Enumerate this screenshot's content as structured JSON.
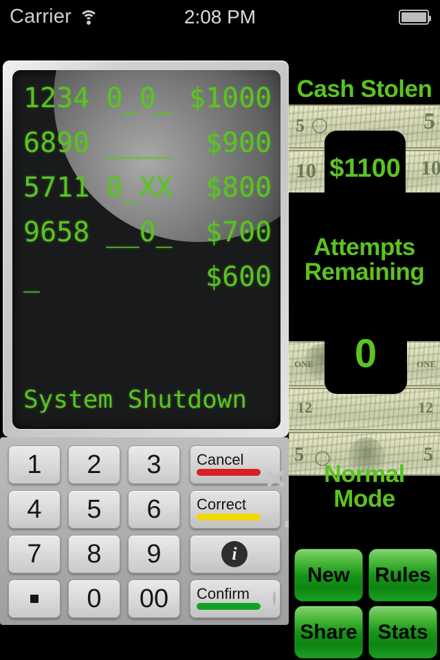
{
  "statusbar": {
    "carrier": "Carrier",
    "time": "2:08 PM",
    "wifi_icon": "wifi-icon",
    "battery_icon": "battery-icon"
  },
  "display": {
    "lines": [
      "1234 0_0_ $1000",
      "6890 ____  $900",
      "5711 0_XX  $800",
      "9658 __0_  $700",
      "_          $600"
    ],
    "status_line": "System Shutdown",
    "text_color": "#5bc322",
    "screen_color": "#191a1c"
  },
  "keypad": {
    "keys": [
      "1",
      "2",
      "3",
      "4",
      "5",
      "6",
      "7",
      "8",
      "9",
      ".",
      "0",
      "00"
    ],
    "side_keys": [
      {
        "label": "Cancel",
        "bar_color": "#d81f22",
        "icon": "close-x-icon"
      },
      {
        "label": "Correct",
        "bar_color": "#f5d700",
        "icon": "chevron-left-icon"
      },
      {
        "label": "",
        "bar_color": "",
        "icon": "info-icon"
      },
      {
        "label": "Confirm",
        "bar_color": "#0fa326",
        "icon": "circle-icon"
      }
    ]
  },
  "right_panel": {
    "cash_title": "Cash Stolen",
    "cash_value": "$1100",
    "attempts_title": "Attempts Remaining",
    "attempts_value": "0",
    "mode_title": "Normal Mode",
    "buttons": [
      {
        "label": "New"
      },
      {
        "label": "Rules"
      },
      {
        "label": "Share"
      },
      {
        "label": "Stats"
      }
    ],
    "accent_green": "#5bc322",
    "button_green": "#149417"
  }
}
